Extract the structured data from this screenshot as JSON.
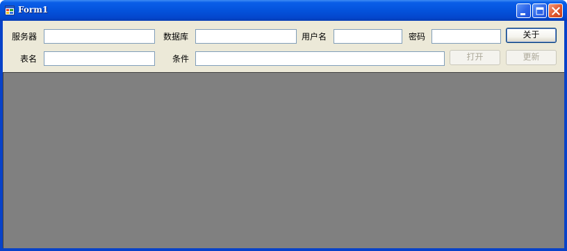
{
  "window": {
    "title": "Form1",
    "icon": "app-form-icon",
    "controls": {
      "minimize": "minimize-icon",
      "maximize": "maximize-icon",
      "close": "close-icon"
    }
  },
  "form": {
    "server_label": "服务器",
    "server_value": "",
    "database_label": "数据库",
    "database_value": "",
    "username_label": "用户名",
    "username_value": "",
    "password_label": "密码",
    "password_value": "",
    "table_label": "表名",
    "table_value": "",
    "condition_label": "条件",
    "condition_value": ""
  },
  "buttons": {
    "about": "关于",
    "open": "打开",
    "refresh": "更新"
  },
  "colors": {
    "titlebar": "#0453dc",
    "window_border": "#0842c8",
    "client_bg": "#ece9d8",
    "grid_bg": "#808080",
    "input_border": "#7f9db9"
  }
}
